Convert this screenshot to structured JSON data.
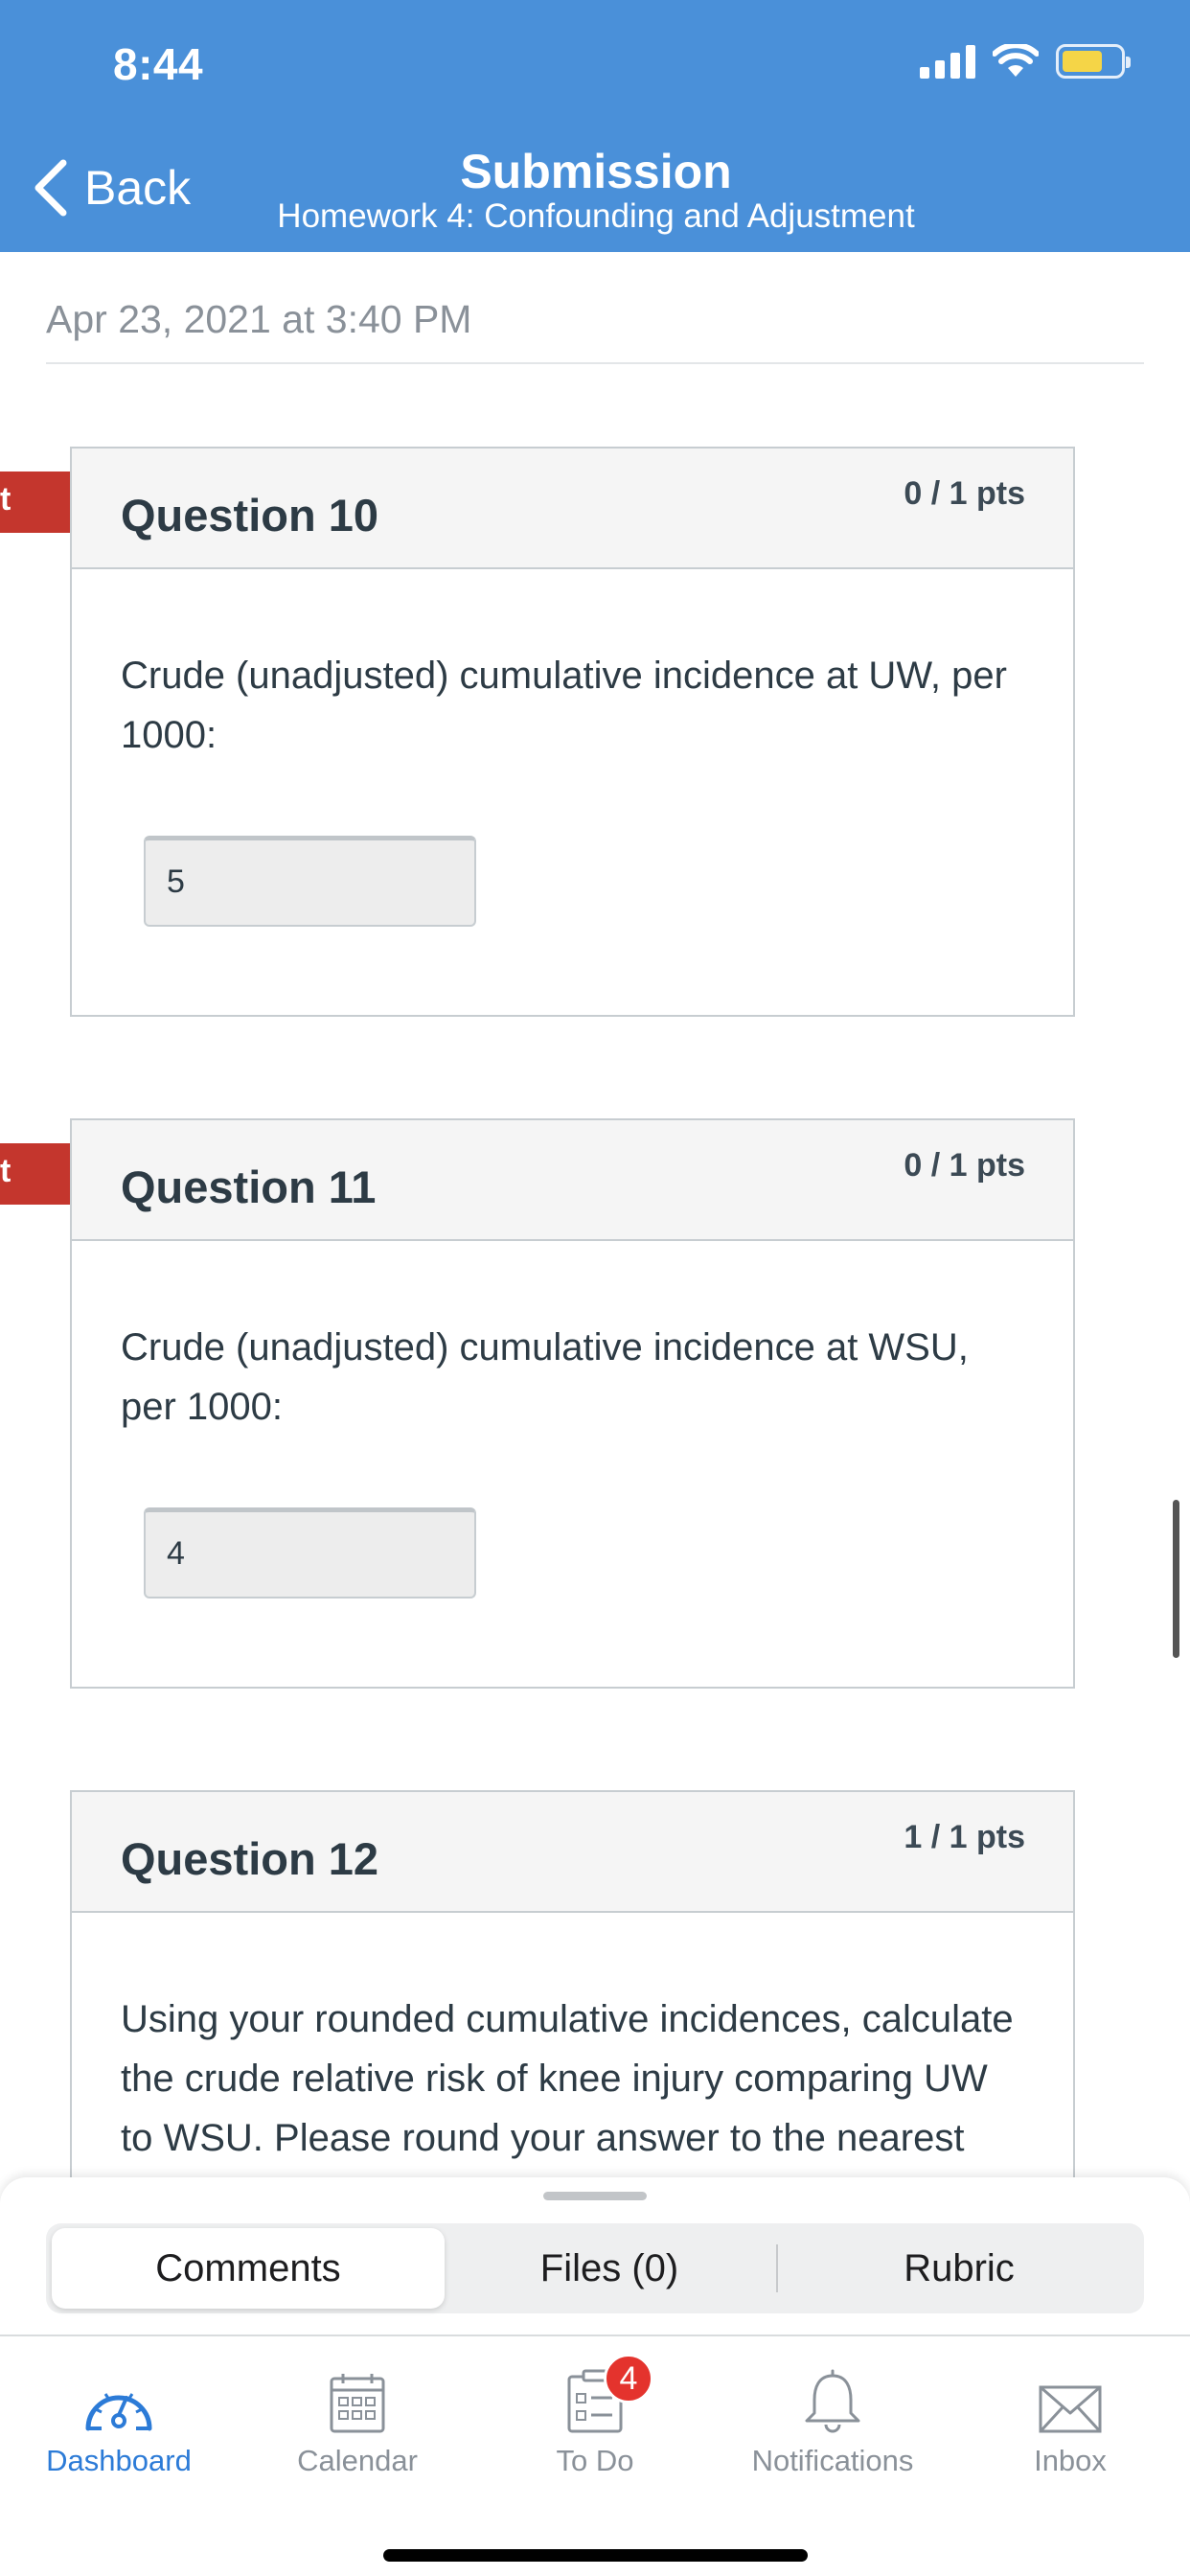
{
  "status_bar": {
    "time": "8:44"
  },
  "nav": {
    "back_label": "Back",
    "title": "Submission",
    "subtitle": "Homework 4: Confounding and Adjustment"
  },
  "submission_date": "Apr 23, 2021 at 3:40 PM",
  "questions": [
    {
      "flag": "t",
      "title": "Question 10",
      "points": "0 / 1 pts",
      "text": "Crude (unadjusted) cumulative incidence at UW, per 1000:",
      "answer": "5"
    },
    {
      "flag": "t",
      "title": "Question 11",
      "points": "0 / 1 pts",
      "text": "Crude (unadjusted) cumulative incidence at WSU, per 1000:",
      "answer": "4"
    },
    {
      "title": "Question 12",
      "points": "1 / 1 pts",
      "text": "Using your rounded cumulative incidences, calculate the crude relative risk of knee injury comparing UW to WSU. Please round your answer to the nearest tenth (#.#)"
    }
  ],
  "sheet_tabs": [
    {
      "label": "Comments",
      "active": true
    },
    {
      "label": "Files (0)",
      "active": false
    },
    {
      "label": "Rubric",
      "active": false
    }
  ],
  "tab_bar": [
    {
      "label": "Dashboard",
      "icon": "dashboard-icon",
      "active": true
    },
    {
      "label": "Calendar",
      "icon": "calendar-icon"
    },
    {
      "label": "To Do",
      "icon": "todo-icon",
      "badge": "4"
    },
    {
      "label": "Notifications",
      "icon": "bell-icon"
    },
    {
      "label": "Inbox",
      "icon": "mail-icon"
    }
  ],
  "colors": {
    "header": "#4a90d9",
    "incorrect_flag": "#c4362d",
    "active_tab": "#2c7bd7",
    "badge": "#e4332d"
  }
}
